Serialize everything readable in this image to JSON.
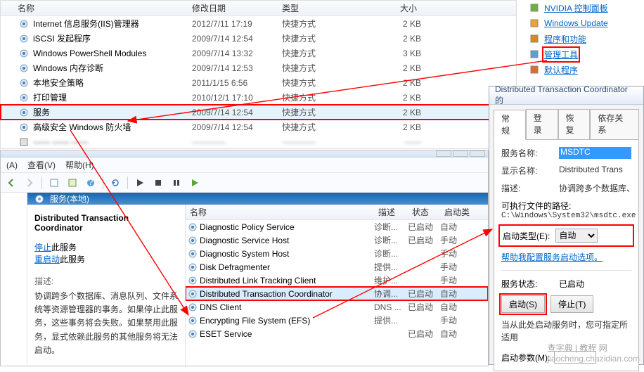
{
  "explorer": {
    "columns": {
      "name": "名称",
      "date": "修改日期",
      "type": "类型",
      "size": "大小"
    },
    "rows": [
      {
        "icon": "iis-icon",
        "name": "Internet 信息服务(IIS)管理器",
        "date": "2012/7/11 17:19",
        "type": "快捷方式",
        "size": "2 KB"
      },
      {
        "icon": "iscsi-icon",
        "name": "iSCSI 发起程序",
        "date": "2009/7/14 12:54",
        "type": "快捷方式",
        "size": "2 KB"
      },
      {
        "icon": "ps-icon",
        "name": "Windows PowerShell Modules",
        "date": "2009/7/14 13:32",
        "type": "快捷方式",
        "size": "3 KB"
      },
      {
        "icon": "memdiag-icon",
        "name": "Windows 内存诊断",
        "date": "2009/7/14 12:53",
        "type": "快捷方式",
        "size": "2 KB"
      },
      {
        "icon": "secpol-icon",
        "name": "本地安全策略",
        "date": "2011/1/15 6:56",
        "type": "快捷方式",
        "size": "2 KB"
      },
      {
        "icon": "print-icon",
        "name": "打印管理",
        "date": "2010/12/1 17:10",
        "type": "快捷方式",
        "size": "2 KB"
      },
      {
        "icon": "services-icon",
        "name": "服务",
        "date": "2009/7/14 12:54",
        "type": "快捷方式",
        "size": "2 KB",
        "highlight": true
      },
      {
        "icon": "firewall-icon",
        "name": "高级安全 Windows 防火墙",
        "date": "2009/7/14 12:54",
        "type": "快捷方式",
        "size": "2 KB"
      }
    ]
  },
  "cpanel": {
    "items": [
      {
        "icon": "nvidia-icon",
        "label": "NVIDIA 控制面板"
      },
      {
        "icon": "wupdate-icon",
        "label": "Windows Update"
      },
      {
        "icon": "programs-icon",
        "label": "程序和功能"
      },
      {
        "icon": "admintools-icon",
        "label": "管理工具",
        "highlight": true
      },
      {
        "icon": "defaultprog-icon",
        "label": "默认程序"
      }
    ]
  },
  "dialog": {
    "title": "Distributed Transaction Coordinator 的",
    "tabs": {
      "general": "常规",
      "logon": "登录",
      "recovery": "恢复",
      "deps": "依存关系"
    },
    "fields": {
      "serviceNameLabel": "服务名称:",
      "serviceName": "MSDTC",
      "displayNameLabel": "显示名称:",
      "displayName": "Distributed Trans",
      "descLabel": "描述:",
      "desc": "协调跨多个数据库、源管理器的事务。如",
      "pathLabel": "可执行文件的路径:",
      "path": "C:\\Windows\\System32\\msdtc.exe",
      "startupLabel": "启动类型(E):",
      "startupValue": "自动",
      "helpLink": "帮助我配置服务启动选项。",
      "statusLabel": "服务状态:",
      "statusValue": "已启动",
      "hint": "当从此处启动服务时，您可指定所适用",
      "paramLabel": "启动参数(M):"
    },
    "buttons": {
      "start": "启动(S)",
      "stop": "停止(T)"
    }
  },
  "mmc": {
    "menus": {
      "a": "(A)",
      "view": "查看(V)",
      "help": "帮助(H)"
    },
    "locHeader": "服务(本地)",
    "detail": {
      "title": "Distributed Transaction Coordinator",
      "stopLink": "停止",
      "stopSuffix": "此服务",
      "restartLink": "重启动",
      "restartSuffix": "此服务",
      "descLabel": "描述:",
      "descBody": "协调跨多个数据库、消息队列、文件系统等资源管理器的事务。如果停止此服务，这些事务将会失败。如果禁用此服务，显式依赖此服务的其他服务将无法启动。"
    },
    "columns": {
      "name": "名称",
      "desc": "描述",
      "status": "状态",
      "startup": "启动类"
    },
    "rows": [
      {
        "name": "Diagnostic Policy Service",
        "desc": "诊断...",
        "status": "已启动",
        "startup": "自动"
      },
      {
        "name": "Diagnostic Service Host",
        "desc": "诊断...",
        "status": "已启动",
        "startup": "手动"
      },
      {
        "name": "Diagnostic System Host",
        "desc": "诊断...",
        "status": "",
        "startup": "手动"
      },
      {
        "name": "Disk Defragmenter",
        "desc": "提供...",
        "status": "",
        "startup": "手动"
      },
      {
        "name": "Distributed Link Tracking Client",
        "desc": "维护...",
        "status": "",
        "startup": "手动"
      },
      {
        "name": "Distributed Transaction Coordinator",
        "desc": "协调...",
        "status": "已启动",
        "startup": "自动",
        "sel": true
      },
      {
        "name": "DNS Client",
        "desc": "DNS ...",
        "status": "已启动",
        "startup": "自动"
      },
      {
        "name": "Encrypting File System (EFS)",
        "desc": "提供...",
        "status": "",
        "startup": "手动"
      },
      {
        "name": "ESET Service",
        "desc": "",
        "status": "已启动",
        "startup": "自动"
      }
    ]
  },
  "watermark": {
    "cn": "查字典 | 教程 网",
    "url": "jiaocheng.chazidian.com"
  }
}
